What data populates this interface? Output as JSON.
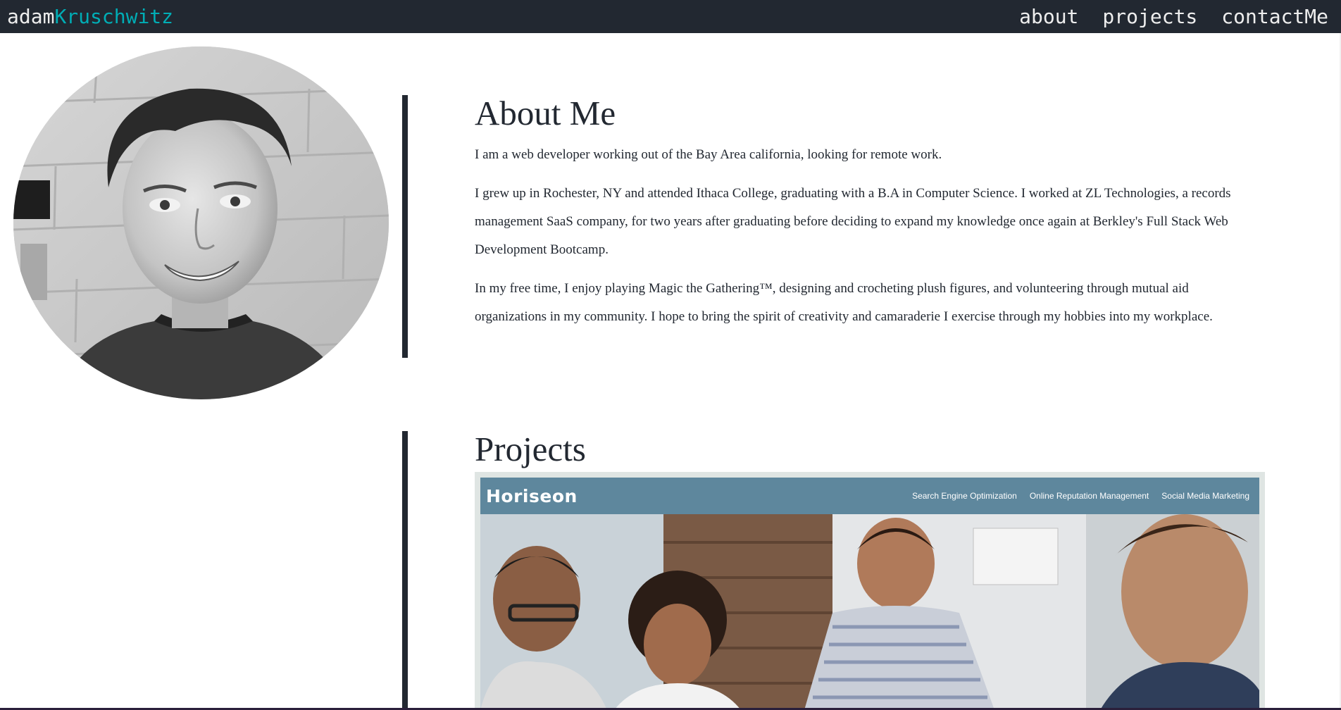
{
  "header": {
    "brand_first": "adam",
    "brand_last": "Kruschwitz",
    "nav": [
      "about",
      "projects",
      "contactMe"
    ]
  },
  "about": {
    "title": "About Me",
    "paragraphs": [
      "I am a web developer working out of the Bay Area california, looking for remote work.",
      "I grew up in Rochester, NY and attended Ithaca College, graduating with a B.A in Computer Science. I worked at ZL Technologies, a records management SaaS company, for two years after graduating before deciding to expand my knowledge once again at Berkley's Full Stack Web Development Bootcamp.",
      "In my free time, I enjoy playing Magic the Gathering™, designing and crocheting plush figures, and volunteering through mutual aid organizations in my community. I hope to bring the spirit of creativity and camaraderie I exercise through my hobbies into my workplace."
    ]
  },
  "projects": {
    "title": "Projects",
    "items": [
      {
        "logo": "Horiseon",
        "nav": [
          "Search Engine Optimization",
          "Online Reputation Management",
          "Social Media Marketing"
        ]
      }
    ]
  },
  "colors": {
    "navbar": "#222831",
    "accent": "#00adb5",
    "text": "#222831",
    "nav_text": "#eeeeee",
    "project_header": "#5e879d"
  },
  "icons": [
    "portrait-photo",
    "project-screenshot"
  ]
}
